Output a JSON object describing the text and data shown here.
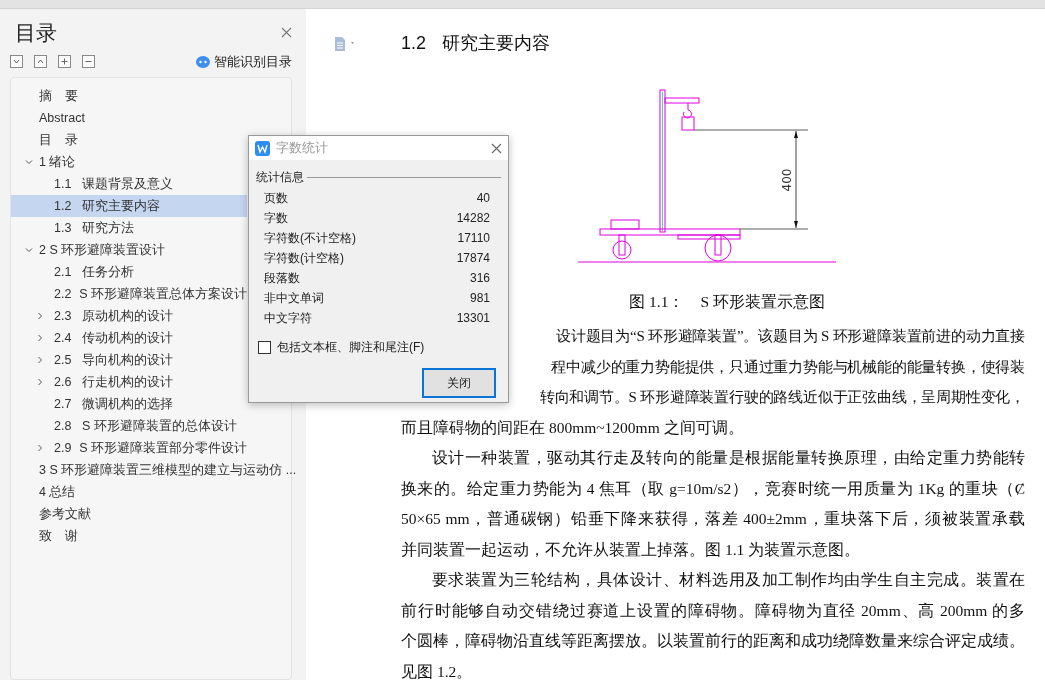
{
  "toc_panel": {
    "title": "目录",
    "smart_button": "智能识别目录",
    "items": [
      {
        "label": "摘　要"
      },
      {
        "label": "Abstract"
      },
      {
        "label": "目　录"
      },
      {
        "label": "1 绪论",
        "expanded": true,
        "children": [
          {
            "number": "1.1",
            "label": "课题背景及意义",
            "selected": false
          },
          {
            "number": "1.2",
            "label": "研究主要内容",
            "selected": true
          },
          {
            "number": "1.3",
            "label": "研究方法",
            "selected": false
          }
        ]
      },
      {
        "label": "2 S 环形避障装置设计",
        "expanded": true,
        "children": [
          {
            "number": "2.1",
            "label": "任务分析",
            "selected": false
          },
          {
            "number": "2.2",
            "label": "S 环形避障装置总体方案设计",
            "selected": false
          },
          {
            "number": "2.3",
            "label": "原动机构的设计",
            "expanded": false,
            "selected": false
          },
          {
            "number": "2.4",
            "label": "传动机构的设计",
            "expanded": false,
            "selected": false
          },
          {
            "number": "2.5",
            "label": "导向机构的设计",
            "expanded": false,
            "selected": false
          },
          {
            "number": "2.6",
            "label": "行走机构的设计",
            "expanded": false,
            "selected": false
          },
          {
            "number": "2.7",
            "label": "微调机构的选择",
            "selected": false
          },
          {
            "number": "2.8",
            "label": "S 环形避障装置的总体设计",
            "selected": false
          },
          {
            "number": "2.9",
            "label": "S 环形避障装置部分零件设计",
            "expanded": false,
            "selected": false
          }
        ]
      },
      {
        "label": "3 S 环形避障装置三维模型的建立与运动仿 ..."
      },
      {
        "label": "4 总结"
      },
      {
        "label": "参考文献"
      },
      {
        "label": "致　谢"
      }
    ]
  },
  "document": {
    "heading_number": "1.2",
    "heading": "研究主要内容",
    "dimension_label": "400",
    "figure_caption": "图 1.1：　S 环形装置示意图",
    "lines": [
      {
        "kind": "covered",
        "text": "设计题目为“S 环形避障装置”。该题目为 S 环形避障装置前进的动力直接"
      },
      {
        "kind": "covered",
        "text": "程中减少的重力势能提供，只通过重力势能与机械能的能量转换，使得装"
      },
      {
        "kind": "covered",
        "text": "转向和调节。S 环形避障装置行驶的路线近似于正弦曲线，呈周期性变化，"
      },
      {
        "kind": "last",
        "text": "而且障碍物的间距在 800mm~1200mm 之间可调。"
      },
      {
        "kind": "indent",
        "text": "设计一种装置，驱动其行走及转向的能量是根据能量转换原理，由给定重力势能转"
      },
      {
        "kind": "full",
        "text": "换来的。给定重力势能为 4 焦耳（取 g=10m/s2），竞赛时统一用质量为 1Kg 的重块（Ȼ"
      },
      {
        "kind": "full",
        "text": "50×65 mm，普通碳钢）铅垂下降来获得，落差 400±2mm，重块落下后，须被装置承载"
      },
      {
        "kind": "last",
        "text": "并同装置一起运动，不允许从装置上掉落。图 1.1 为装置示意图。"
      },
      {
        "kind": "indent",
        "text": "要求装置为三轮结构，具体设计、材料选用及加工制作均由学生自主完成。装置在"
      },
      {
        "kind": "full",
        "text": "前行时能够自动交错绕过赛道上设置的障碍物。障碍物为直径 20mm、高 200mm 的多"
      },
      {
        "kind": "full",
        "text": "个圆棒，障碍物沿直线等距离摆放。以装置前行的距离和成功绕障数量来综合评定成绩。"
      },
      {
        "kind": "last",
        "text": "见图 1.2。"
      }
    ]
  },
  "dialog": {
    "title": "字数统计",
    "group": "统计信息",
    "stats": [
      {
        "label": "页数",
        "value": "40"
      },
      {
        "label": "字数",
        "value": "14282"
      },
      {
        "label": "字符数(不计空格)",
        "value": "17110"
      },
      {
        "label": "字符数(计空格)",
        "value": "17874"
      },
      {
        "label": "段落数",
        "value": "316"
      },
      {
        "label": "非中文单词",
        "value": "981"
      },
      {
        "label": "中文字符",
        "value": "13301"
      }
    ],
    "checkbox": {
      "label": "包括文本框、脚注和尾注(F)",
      "checked": false
    },
    "button": "关闭"
  }
}
